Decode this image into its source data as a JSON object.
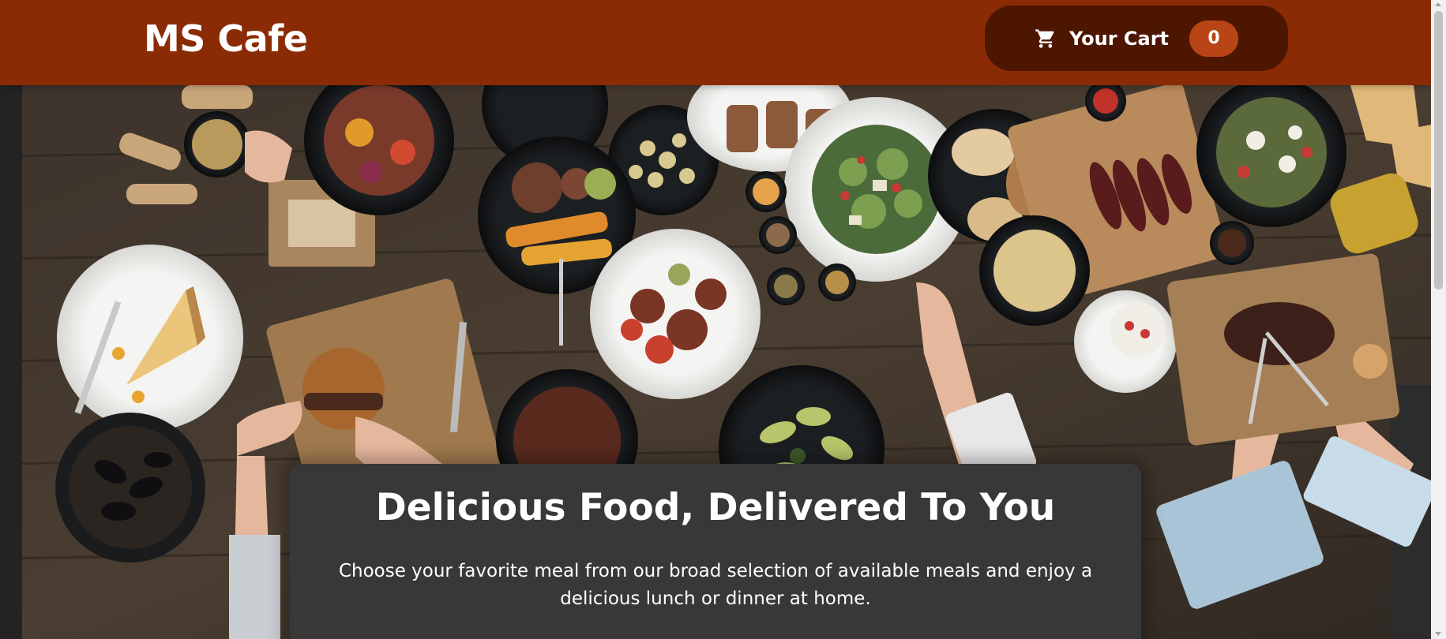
{
  "header": {
    "brand": "MS Cafe",
    "cart": {
      "label": "Your Cart",
      "count": "0",
      "icon": "cart-icon"
    }
  },
  "hero": {
    "image_alt": "A table full of delicious food!"
  },
  "summary": {
    "title": "Delicious Food, Delivered To You",
    "text": "Choose your favorite meal from our broad selection of available meals and enjoy a delicious lunch or dinner at home."
  },
  "colors": {
    "header_bg": "#8a2b06",
    "cart_button_bg": "#4d1601",
    "badge_bg": "#b94517",
    "page_bg": "#383838"
  }
}
